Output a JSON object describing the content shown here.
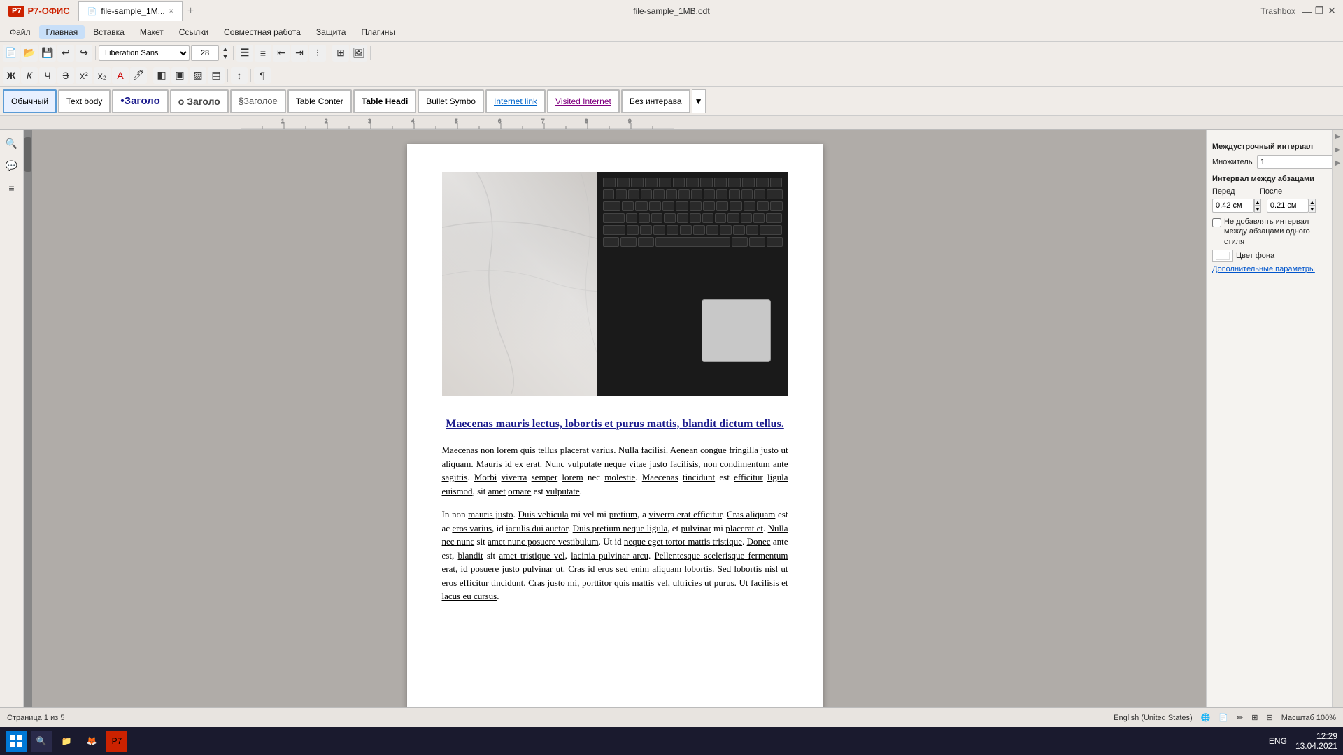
{
  "app": {
    "name": "Р7-ОФИС",
    "title_bar_file": "file-sample_1MB.odt",
    "trashbox": "Trashbox"
  },
  "tab": {
    "label": "file-sample_1M...",
    "close": "×"
  },
  "menu": {
    "items": [
      "Файл",
      "Главная",
      "Вставка",
      "Макет",
      "Ссылки",
      "Совместная работа",
      "Защита",
      "Плагины"
    ]
  },
  "toolbar1": {
    "font_name": "Liberation Sans",
    "font_size": "28"
  },
  "styles": {
    "items": [
      "Обычный",
      "Text body",
      "•Заголо",
      "о Заголо",
      "§Заголое",
      "Table Conter",
      "Table Headi",
      "Bullet Symbo",
      "Internet link",
      "Visited Internet",
      "Без интерава"
    ]
  },
  "ruler": {
    "label": ""
  },
  "doc": {
    "heading": "Maecenas mauris lectus, lobortis et purus mattis, blandit dictum tellus.",
    "para1": "Maecenas non lorem quis tellus placerat varius. Nulla facilisi. Aenean congue fringilla justo ut aliquam. Mauris id ex erat. Nunc vulputate neque vitae justo facilisis, non condimentum ante sagittis. Morbi viverra semper lorem nec molestie. Maecenas tincidunt est efficitur ligula euismod, sit amet ornare est vulputate.",
    "para2": "In non mauris justo. Duis vehicula mi vel mi pretium, a viverra erat efficitur. Cras aliquam est ac eros varius, id iaculis dui auctor. Duis pretium neque ligula, et pulvinar mi placerat et. Nulla nec nunc sit amet nunc posuere vestibulum. Ut id neque eget tortor mattis tristique. Donec ante est, blandit sit amet tristique vel, lacinia pulvinar arcu. Pellentesque scelerisque fermentum erat, id posuere justo pulvinar ut. Cras id eros sed enim aliquam lobortis. Sed lobortis nisl ut eros efficitur tincidunt. Cras justo mi, porttitor quis mattis vel, ultricies ut purus. Ut facilisis et lacus eu cursus."
  },
  "right_panel": {
    "line_spacing_title": "Междустрочный интервал",
    "multiplier_label": "Множитель",
    "multiplier_value": "1",
    "para_spacing_title": "Интервал между абзацами",
    "before_label": "Перед",
    "before_value": "0.42 см",
    "after_label": "После",
    "after_value": "0.21 см",
    "no_add_label": "Не добавлять интервал между абзацами одного стиля",
    "bg_color_label": "Цвет фона",
    "extra_params_label": "Дополнительные параметры"
  },
  "statusbar": {
    "page_info": "Страница 1 из 5",
    "language": "English (United States)",
    "zoom": "Масштаб 100%"
  },
  "taskbar": {
    "time": "12:29",
    "date": "13.04.2021",
    "layout": "ENG"
  }
}
